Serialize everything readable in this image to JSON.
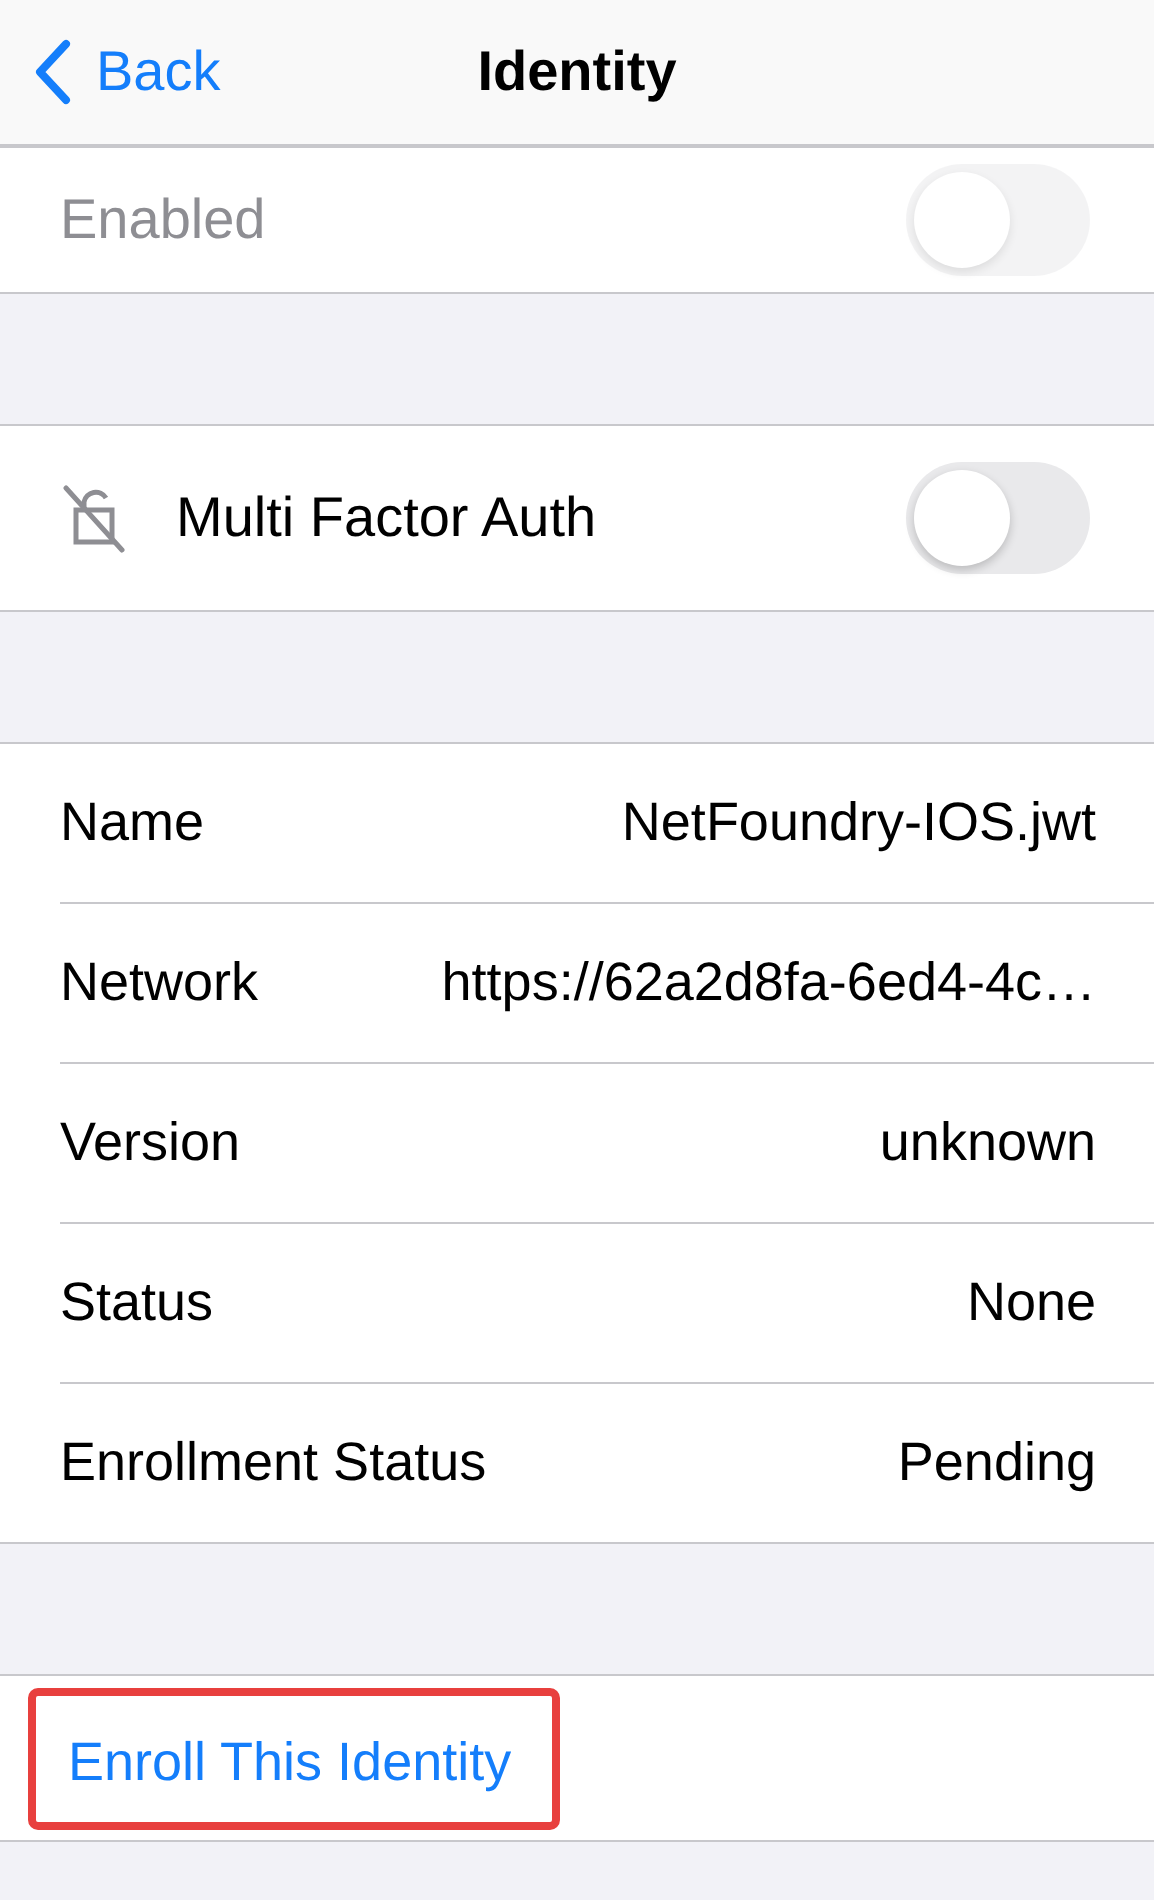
{
  "nav": {
    "back_label": "Back",
    "title": "Identity"
  },
  "enabled": {
    "label": "Enabled",
    "disabled": true,
    "on": false
  },
  "mfa": {
    "label": "Multi Factor Auth",
    "on": false
  },
  "details": [
    {
      "label": "Name",
      "value": "NetFoundry-IOS.jwt"
    },
    {
      "label": "Network",
      "value": "https://62a2d8fa-6ed4-4c…"
    },
    {
      "label": "Version",
      "value": "unknown"
    },
    {
      "label": "Status",
      "value": "None"
    },
    {
      "label": "Enrollment Status",
      "value": "Pending"
    }
  ],
  "action": {
    "label": "Enroll This Identity",
    "highlighted": true
  }
}
